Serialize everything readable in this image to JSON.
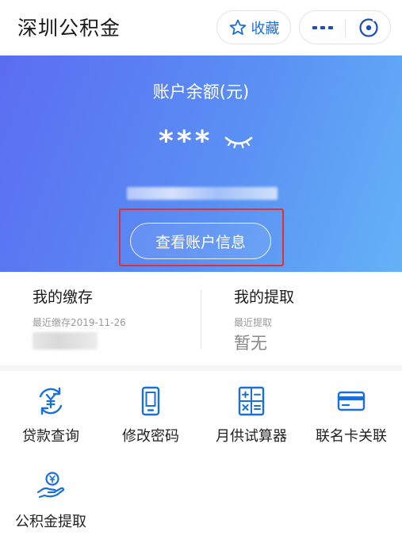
{
  "header": {
    "title": "深圳公积金",
    "favorite_label": "收藏"
  },
  "account": {
    "balance_label": "账户余额(元)",
    "balance_value": "***",
    "view_button_label": "查看账户信息"
  },
  "summary": {
    "deposit": {
      "title": "我的缴存",
      "subtitle": "最近缴存2019-11-26"
    },
    "withdrawal": {
      "title": "我的提取",
      "subtitle": "最近提取",
      "value": "暂无"
    }
  },
  "services": [
    {
      "label": "贷款查询",
      "icon": "loan-query-icon"
    },
    {
      "label": "修改密码",
      "icon": "phone-icon"
    },
    {
      "label": "月供试算器",
      "icon": "calculator-icon"
    },
    {
      "label": "联名卡关联",
      "icon": "bank-card-icon"
    },
    {
      "label": "公积金提取",
      "icon": "hand-coin-icon"
    }
  ],
  "colors": {
    "brand_blue": "#1b6fd8",
    "hero_gradient_start": "#5b6df2",
    "hero_gradient_end": "#64b2f7",
    "highlight_red": "#e03131"
  }
}
